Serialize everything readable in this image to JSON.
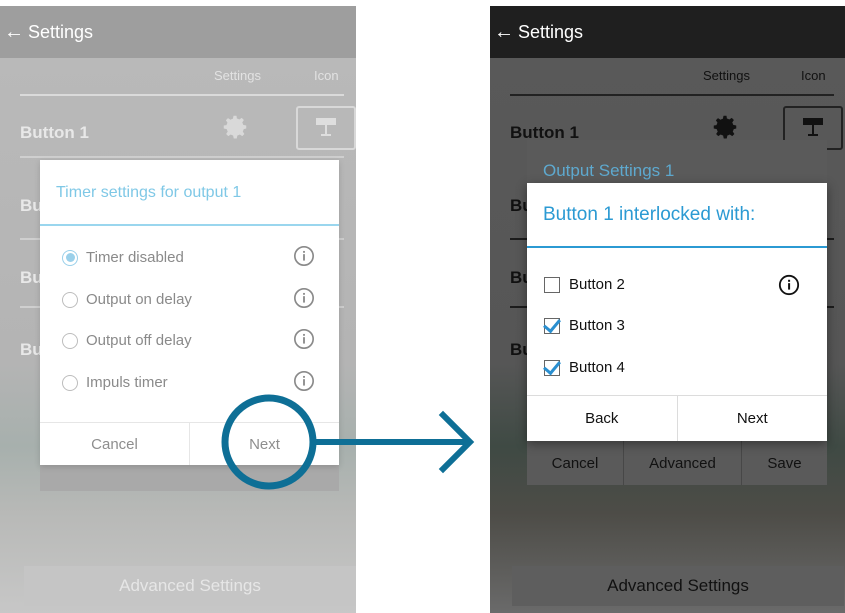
{
  "left_screen": {
    "appbar": {
      "title": "Settings"
    },
    "columns": {
      "settings": "Settings",
      "icon": "Icon"
    },
    "rows": [
      {
        "label": "Button 1"
      },
      {
        "label": "Bu"
      },
      {
        "label": "Bu"
      },
      {
        "label": "Bu"
      }
    ],
    "advanced_button": "Advanced Settings",
    "dialog": {
      "title": "Timer settings for output 1",
      "options": [
        {
          "label": "Timer disabled",
          "selected": true
        },
        {
          "label": "Output on delay",
          "selected": false
        },
        {
          "label": "Output off delay",
          "selected": false
        },
        {
          "label": "Impuls timer",
          "selected": false
        }
      ],
      "cancel": "Cancel",
      "next": "Next"
    }
  },
  "right_screen": {
    "appbar": {
      "title": "Settings"
    },
    "columns": {
      "settings": "Settings",
      "icon": "Icon"
    },
    "rows": [
      {
        "label": "Button 1"
      },
      {
        "label": "Bu"
      },
      {
        "label": "Bu"
      },
      {
        "label": "Bu"
      }
    ],
    "advanced_button": "Advanced Settings",
    "behind_dialog": {
      "title": "Output Settings 1",
      "buttons": {
        "cancel": "Cancel",
        "advanced": "Advanced",
        "save": "Save"
      }
    },
    "dialog": {
      "title": "Button 1 interlocked with:",
      "items": [
        {
          "label": "Button 2",
          "checked": false
        },
        {
          "label": "Button 3",
          "checked": true
        },
        {
          "label": "Button 4",
          "checked": true
        }
      ],
      "back": "Back",
      "next": "Next"
    }
  },
  "colors": {
    "accent": "#2b9ad3",
    "highlight": "#0e6f96"
  },
  "icons": [
    "back-arrow-icon",
    "gear-icon",
    "output-icon",
    "info-icon",
    "arrow-right-icon"
  ]
}
